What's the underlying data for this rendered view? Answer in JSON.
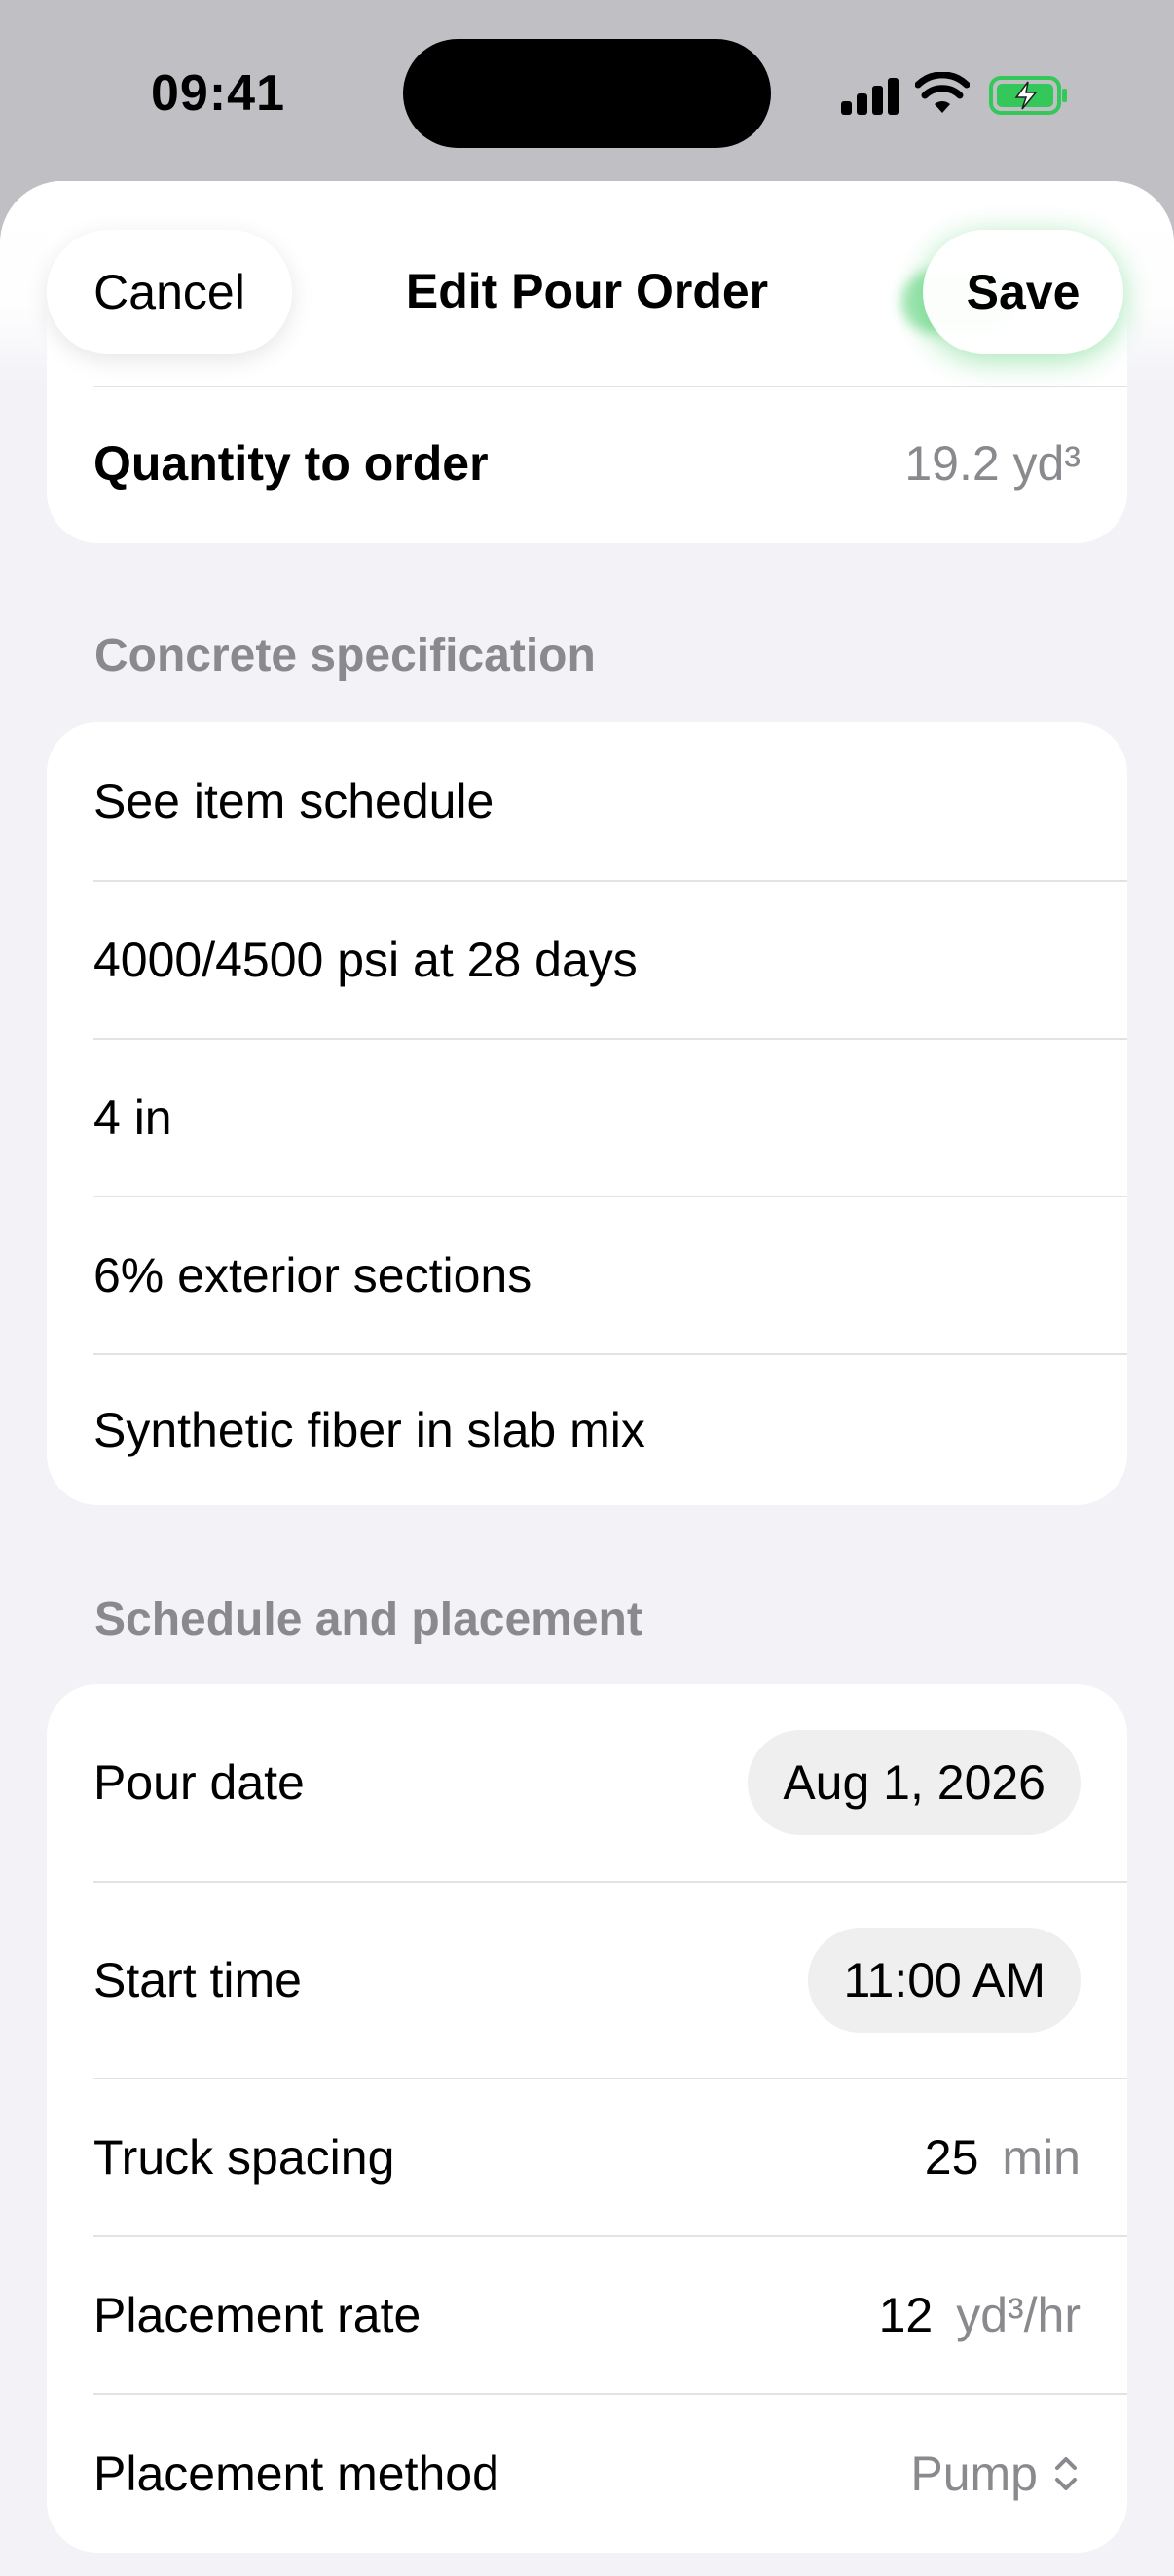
{
  "status": {
    "time": "09:41"
  },
  "nav": {
    "cancel_label": "Cancel",
    "title": "Edit Pour Order",
    "save_label": "Save"
  },
  "summary": {
    "quantity_label": "Quantity to order",
    "quantity_value": "19.2 yd³"
  },
  "concrete": {
    "header": "Concrete specification",
    "items": [
      "See item schedule",
      "4000/4500 psi at 28 days",
      "4 in",
      "6% exterior sections",
      "Synthetic fiber in slab mix"
    ]
  },
  "schedule": {
    "header": "Schedule and placement",
    "pour_date_label": "Pour date",
    "pour_date_value": "Aug 1, 2026",
    "start_time_label": "Start time",
    "start_time_value": "11:00 AM",
    "truck_spacing_label": "Truck spacing",
    "truck_spacing_value": "25",
    "truck_spacing_unit": "min",
    "placement_rate_label": "Placement rate",
    "placement_rate_value": "12",
    "placement_rate_unit": "yd³/hr",
    "placement_method_label": "Placement method",
    "placement_method_value": "Pump"
  },
  "icons": [
    "signal-icon",
    "wifi-icon",
    "battery-charging-icon",
    "chevron-up-down-icon"
  ],
  "colors": {
    "accent_green": "#34c759",
    "background": "#f2f2f7",
    "secondary_text": "#8a8a8e"
  }
}
